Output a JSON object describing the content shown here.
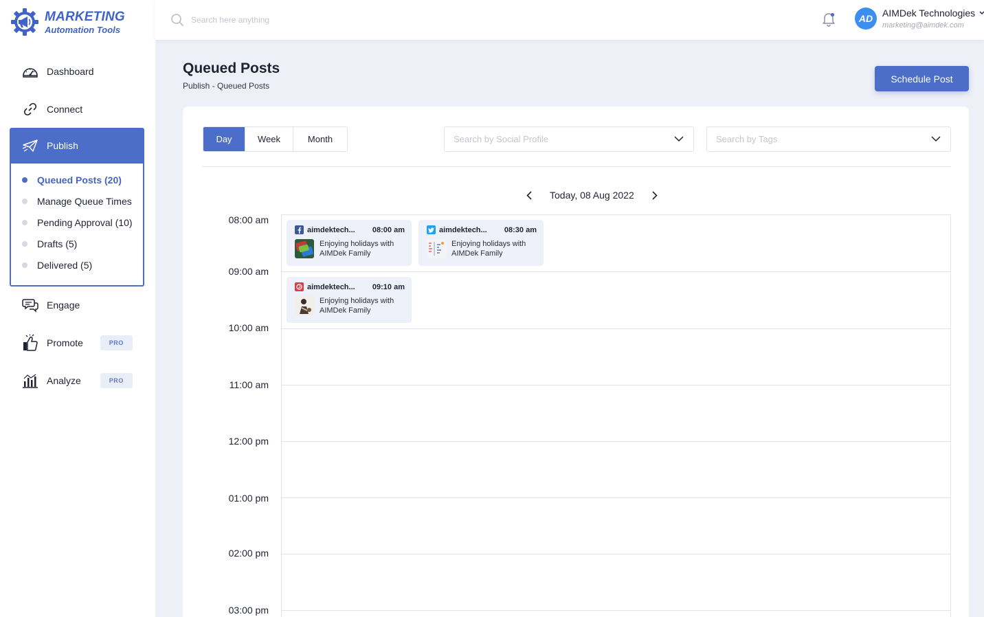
{
  "brand": {
    "line1": "MARKETING",
    "line2": "Automation Tools"
  },
  "nav": {
    "dashboard": "Dashboard",
    "connect": "Connect",
    "publish": "Publish",
    "engage": "Engage",
    "promote": "Promote",
    "analyze": "Analyze",
    "pro_badge": "PRO"
  },
  "publish_sub": [
    {
      "label": "Queued Posts (20)",
      "active": true
    },
    {
      "label": "Manage Queue Times"
    },
    {
      "label": "Pending Approval (10)"
    },
    {
      "label": "Drafts (5)"
    },
    {
      "label": "Delivered (5)"
    }
  ],
  "topbar": {
    "search_placeholder": "Search here anything",
    "avatar_initials": "AD",
    "user_name": "AIMDek Technologies",
    "user_email": "marketing@aimdek.com"
  },
  "header": {
    "title": "Queued Posts",
    "breadcrumb": "Publish - Queued Posts",
    "schedule_button": "Schedule Post"
  },
  "filters": {
    "views": [
      "Day",
      "Week",
      "Month"
    ],
    "active_view": "Day",
    "social_profile_placeholder": "Search by Social Profile",
    "tags_placeholder": "Search by Tags"
  },
  "calendar": {
    "date_label": "Today, 08 Aug 2022",
    "times": [
      "08:00 am",
      "09:00 am",
      "10:00 am",
      "11:00 am",
      "12:00 pm",
      "01:00 pm",
      "02:00 pm",
      "03:00 pm"
    ],
    "posts": [
      {
        "network": "facebook",
        "account": "aimdektech...",
        "time": "08:00 am",
        "text_line1": "Enjoying holidays with",
        "text_line2": "AIMDek Family",
        "color": "#3b5998"
      },
      {
        "network": "twitter",
        "account": "aimdektech...",
        "time": "08:30 am",
        "text_line1": "Enjoying holidays with",
        "text_line2": "AIMDek Family",
        "color": "#1da1f2"
      },
      {
        "network": "pinterest",
        "account": "aimdektech...",
        "time": "09:10 am",
        "text_line1": "Enjoying holidays with",
        "text_line2": "AIMDek Family",
        "color": "#e03a45"
      }
    ]
  },
  "colors": {
    "accent": "#4c6ec8",
    "background": "#eef0f8"
  }
}
